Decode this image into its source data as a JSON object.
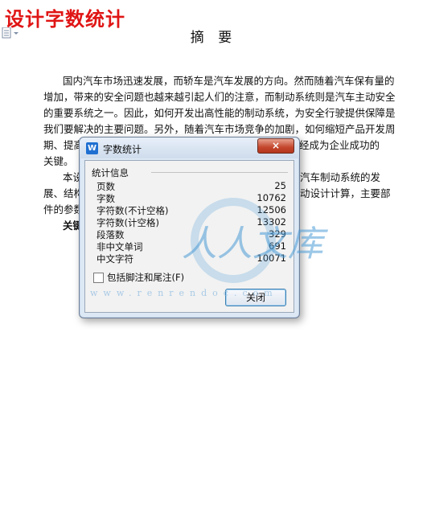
{
  "page_heading": "设计字数统计",
  "document": {
    "title": "摘 要",
    "paragraph1": [
      "国内汽车市场迅速发展，而轿车是汽车发展的方向。然而随着汽车保有量的",
      "增加，带来的安全问题也越来越引起人们的注意，而制动系统则是汽车主动安全",
      "的重要系统之一。因此，如何开发出高性能的制动系统，为安全行驶提供保障是",
      "我们要解决的主要问题。另外，随着汽车市场竞争的加剧，如何缩短产品开发周",
      "期、提高",
      "关键。"
    ],
    "paragraph1_tail": "经成为企业成功的",
    "paragraph2": [
      "本设",
      "展、结构",
      "件的参数"
    ],
    "paragraph2_tails": [
      "汽车制动系统的发",
      "动设计计算，主要部",
      ""
    ],
    "keywords_label": "关键"
  },
  "dialog": {
    "title": "字数统计",
    "close_x": "×",
    "section_label": "统计信息",
    "stats": [
      {
        "label": "页数",
        "value": "25"
      },
      {
        "label": "字数",
        "value": "10762"
      },
      {
        "label": "字符数(不计空格)",
        "value": "12506"
      },
      {
        "label": "字符数(计空格)",
        "value": "13302"
      },
      {
        "label": "段落数",
        "value": "329"
      },
      {
        "label": "非中文单词",
        "value": "691"
      },
      {
        "label": "中文字符",
        "value": "10071"
      }
    ],
    "checkbox_label": "包括脚注和尾注(F)",
    "checkbox_checked": false,
    "close_button": "关闭"
  },
  "watermark": {
    "text": "人人文库",
    "url": "www.renrendoc.com"
  },
  "colors": {
    "heading_red": "#e01515",
    "dialog_bg": "#dde8f5",
    "watermark_blue": "#4a9ad6"
  }
}
